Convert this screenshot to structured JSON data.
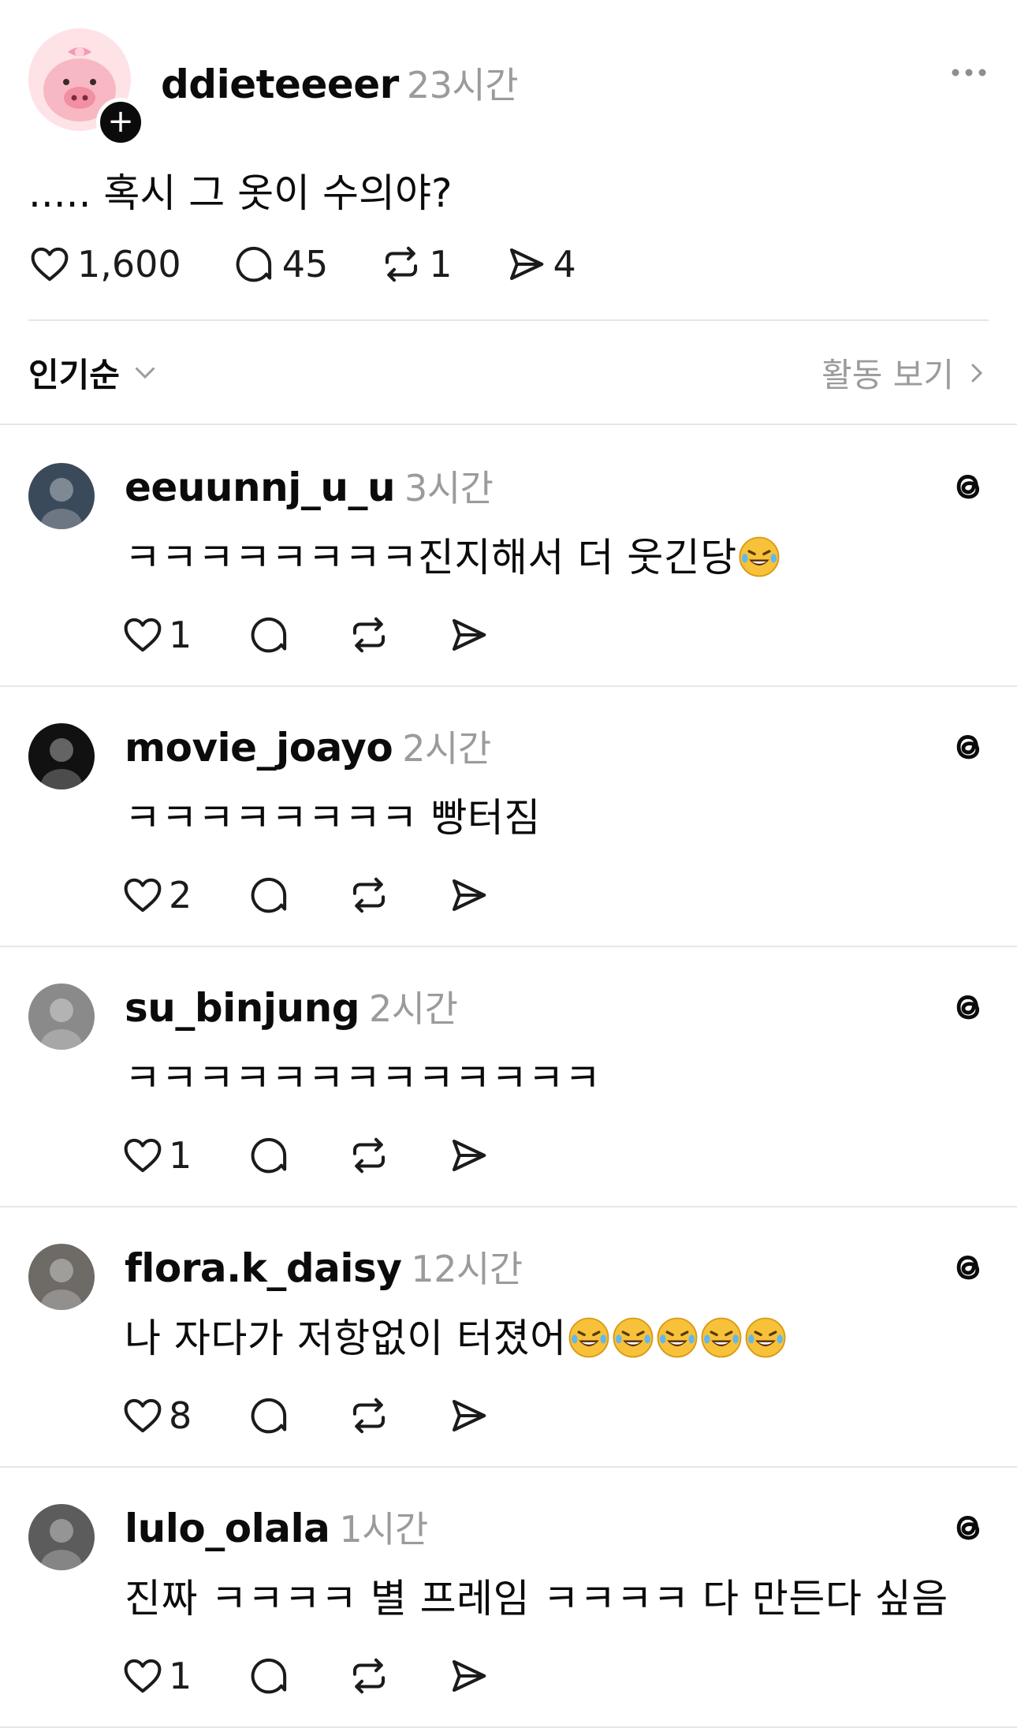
{
  "post": {
    "username": "ddieteeeer",
    "time": "23시간",
    "text": "..... 혹시 그 옷이 수의야?",
    "likes": "1,600",
    "replies": "45",
    "reposts": "1",
    "shares": "4"
  },
  "sort": {
    "label": "인기순",
    "activity_label": "활동 보기"
  },
  "comments": [
    {
      "username": "eeuunnj_u_u",
      "time": "3시간",
      "text": "ㅋㅋㅋㅋㅋㅋㅋㅋ진지해서 더 웃긴당",
      "emoji_count": 1,
      "likes": "1",
      "avatar_color": "#3b4a5a"
    },
    {
      "username": "movie_joayo",
      "time": "2시간",
      "text": "ㅋㅋㅋㅋㅋㅋㅋㅋ 빵터짐",
      "emoji_count": 0,
      "likes": "2",
      "avatar_color": "#111111"
    },
    {
      "username": "su_binjung",
      "time": "2시간",
      "text": "ㅋㅋㅋㅋㅋㅋㅋㅋㅋㅋㅋㅋㅋ",
      "emoji_count": 0,
      "likes": "1",
      "avatar_color": "#8a8a8a"
    },
    {
      "username": "flora.k_daisy",
      "time": "12시간",
      "text": "나 자다가 저항없이 터졌어",
      "emoji_count": 5,
      "likes": "8",
      "avatar_color": "#6e6a66"
    },
    {
      "username": "lulo_olala",
      "time": "1시간",
      "text": "진짜 ㅋㅋㅋㅋ 별 프레임 ㅋㅋㅋㅋ 다 만든다 싶음",
      "emoji_count": 0,
      "likes": "1",
      "avatar_color": "#5c5c5c"
    }
  ],
  "colors": {
    "text": "#0b0b0b",
    "muted": "#9b9b9b",
    "divider": "#e6e6e6"
  },
  "icons": [
    "more-icon",
    "heart-icon",
    "comment-icon",
    "repost-icon",
    "share-icon",
    "threads-icon",
    "chevron-down-icon",
    "chevron-right-icon",
    "rofl-emoji"
  ]
}
